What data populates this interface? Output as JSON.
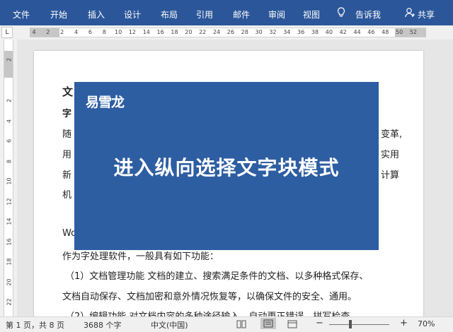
{
  "ribbon": {
    "tabs": [
      "文件",
      "开始",
      "插入",
      "设计",
      "布局",
      "引用",
      "邮件",
      "审阅",
      "视图"
    ],
    "tell_me": "告诉我",
    "share": "共享"
  },
  "ruler": {
    "corner": "L",
    "h_labels": [
      "4",
      "2",
      "2",
      "4",
      "6",
      "8",
      "10",
      "12",
      "14",
      "16",
      "18",
      "20",
      "22",
      "24",
      "26",
      "28",
      "30",
      "32",
      "34",
      "36",
      "38",
      "40",
      "42",
      "44",
      "46",
      "48",
      "50",
      "52"
    ],
    "v_labels": [
      "2",
      "2",
      "4",
      "6",
      "8",
      "10",
      "12",
      "14",
      "16",
      "18",
      "20",
      "22"
    ]
  },
  "document": {
    "lines": [
      "文",
      "字",
      "随",
      "用",
      "新",
      "机",
      "Wo",
      "作为字处理软件，一般具有如下功能：",
      "（1）文档管理功能    文档的建立、搜索满足条件的文档、以多种格式保存、",
      "文档自动保存、文档加密和意外情况恢复等，以确保文件的安全、通用。",
      "（2）编辑功能    对文档内容的多种途径输入，自动更正错误，拼写检查，"
    ],
    "right_fragments": [
      "变革,",
      "实用",
      "计算"
    ]
  },
  "overlay": {
    "brand": "易雪龙",
    "headline": "进入纵向选择文字块模式",
    "color": "#2e5ea2"
  },
  "status": {
    "page": "第 1 页，共 8 页",
    "words": "3688 个字",
    "language": "中文(中国)",
    "zoom": "70%"
  },
  "colors": {
    "ribbon": "#2b579a"
  }
}
